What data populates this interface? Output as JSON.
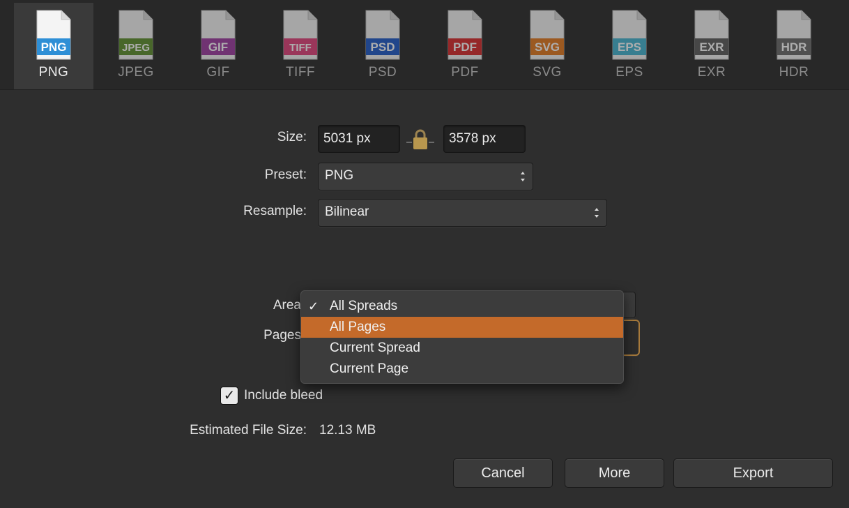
{
  "formats": [
    {
      "badge": "PNG",
      "name": "PNG",
      "color": "#2e8fd6",
      "active": true
    },
    {
      "badge": "JPEG",
      "name": "JPEG",
      "color": "#5c8f2c",
      "active": false
    },
    {
      "badge": "GIF",
      "name": "GIF",
      "color": "#9c3aa0",
      "active": false
    },
    {
      "badge": "TIFF",
      "name": "TIFF",
      "color": "#e0407a",
      "active": false
    },
    {
      "badge": "PSD",
      "name": "PSD",
      "color": "#1d59c8",
      "active": false
    },
    {
      "badge": "PDF",
      "name": "PDF",
      "color": "#d8282a",
      "active": false
    },
    {
      "badge": "SVG",
      "name": "SVG",
      "color": "#e2781e",
      "active": false
    },
    {
      "badge": "EPS",
      "name": "EPS",
      "color": "#42b3d0",
      "active": false
    },
    {
      "badge": "EXR",
      "name": "EXR",
      "color": "#5a5a5a",
      "active": false
    },
    {
      "badge": "HDR",
      "name": "HDR",
      "color": "#6a6a6a",
      "active": false
    }
  ],
  "size": {
    "label": "Size:",
    "width": "5031 px",
    "height": "3578 px"
  },
  "preset": {
    "label": "Preset:",
    "value": "PNG"
  },
  "resample": {
    "label": "Resample:",
    "value": "Bilinear"
  },
  "area": {
    "label": "Area"
  },
  "pages": {
    "label": "Pages"
  },
  "area_menu": {
    "items": [
      "All Spreads",
      "All Pages",
      "Current Spread",
      "Current Page"
    ],
    "checked": "All Spreads",
    "highlighted": "All Pages",
    "check_glyph": "✓"
  },
  "bleed": {
    "label": "Include bleed",
    "checked": true,
    "check_glyph": "✓"
  },
  "file_size": {
    "label": "Estimated File Size:",
    "value": "12.13 MB"
  },
  "buttons": {
    "cancel": "Cancel",
    "more": "More",
    "export": "Export"
  }
}
